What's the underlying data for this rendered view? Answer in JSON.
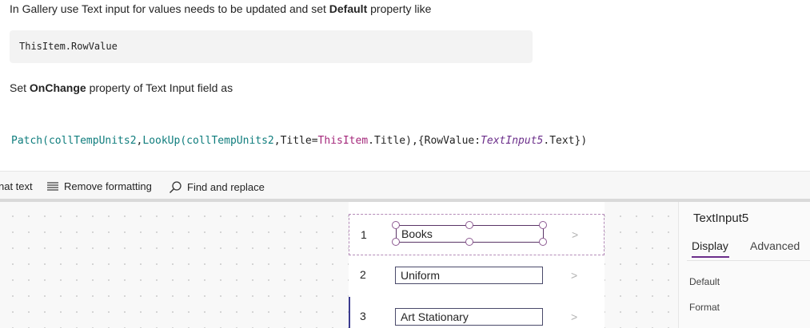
{
  "article": {
    "p1_pre": "In Gallery use Text input for values needs to be updated and set ",
    "p1_bold": "Default",
    "p1_post": " property like",
    "code1": "ThisItem.RowValue",
    "p2_pre": "Set ",
    "p2_bold": "OnChange",
    "p2_post": " property of Text Input field as",
    "code2": {
      "t1": "Patch(",
      "t2": "collTempUnits2",
      "t3": ",",
      "t4": "LookUp(",
      "t5": "collTempUnits2",
      "t6": ",",
      "t7": "Title",
      "t8": "=",
      "t9": "ThisItem",
      "t10": ".",
      "t11": "Title",
      "t12": "),{",
      "t13": "RowValue",
      "t14": ":",
      "t15": "TextInput5",
      "t16": ".",
      "t17": "Text",
      "t18": "})"
    }
  },
  "toolbar": {
    "format_text": "nat text",
    "remove_formatting": "Remove formatting",
    "find_replace": "Find and replace"
  },
  "gallery": {
    "rows": [
      {
        "num": "1",
        "value": "Books"
      },
      {
        "num": "2",
        "value": "Uniform"
      },
      {
        "num": "3",
        "value": "Art Stationary"
      }
    ],
    "chevron": ">"
  },
  "properties": {
    "control_name": "TextInput5",
    "tabs": [
      "Display",
      "Advanced"
    ],
    "labels": [
      "Default",
      "Format"
    ]
  },
  "colors": {
    "accent": "#6b2e8a",
    "function": "#0f7d7d",
    "keyword": "#a4277a"
  }
}
